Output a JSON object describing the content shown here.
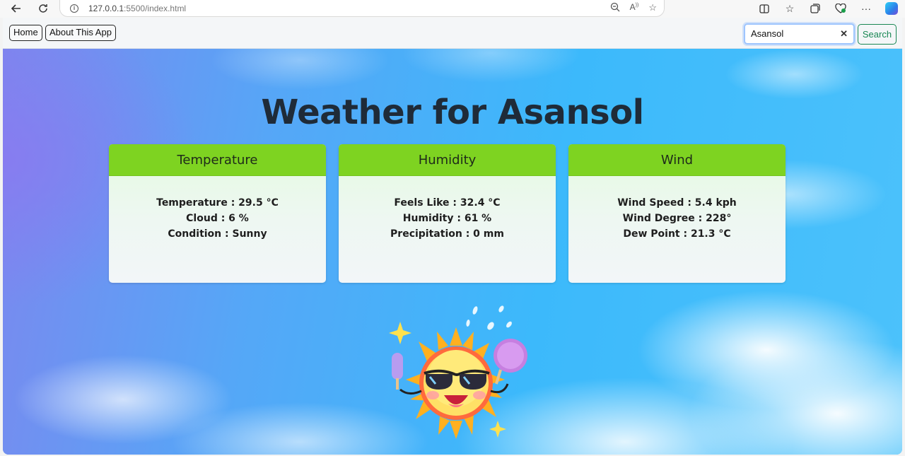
{
  "browser": {
    "url_host": "127.0.0.1",
    "url_rest": ":5500/index.html"
  },
  "nav": {
    "home_label": "Home",
    "about_label": "About This App",
    "search_value": "Asansol",
    "search_button_label": "Search"
  },
  "page": {
    "heading": "Weather for Asansol"
  },
  "cards": [
    {
      "title": "Temperature",
      "lines": [
        "Temperature : 29.5 °C",
        "Cloud : 6 %",
        "Condition : Sunny"
      ]
    },
    {
      "title": "Humidity",
      "lines": [
        "Feels Like : 32.4 °C",
        "Humidity : 61 %",
        "Precipitation : 0 mm"
      ]
    },
    {
      "title": "Wind",
      "lines": [
        "Wind Speed : 5.4 kph",
        "Wind Degree : 228°",
        "Dew Point : 21.3 °C"
      ]
    }
  ],
  "colors": {
    "card_header": "#7ed321",
    "search_button": "#198754",
    "heading": "#1f2b38"
  },
  "icons": [
    "back-arrow-icon",
    "reload-icon",
    "info-icon",
    "zoom-out-icon",
    "read-aloud-icon",
    "favorite-star-icon",
    "split-screen-icon",
    "favorites-icon",
    "collections-icon",
    "browser-essentials-icon",
    "more-icon",
    "copilot-icon",
    "clear-icon",
    "sun-mascot-icon"
  ]
}
